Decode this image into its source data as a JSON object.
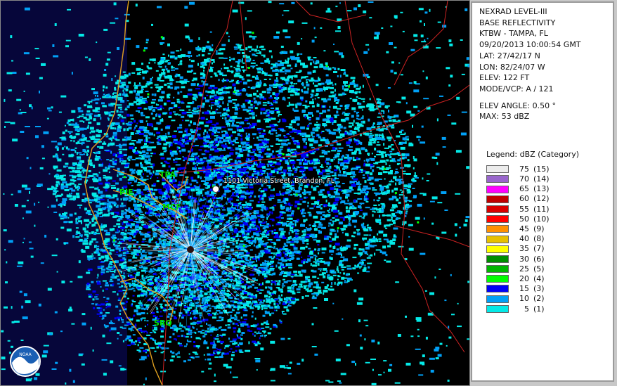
{
  "radar_info": {
    "product": "NEXRAD LEVEL-III",
    "type": "BASE REFLECTIVITY",
    "station": "KTBW - TAMPA, FL",
    "datetime": "09/20/2013 10:00:54 GMT",
    "lat": "LAT: 27/42/17 N",
    "lon": "LON: 82/24/07 W",
    "elev": "ELEV: 122 FT",
    "mode": "MODE/VCP: A / 121",
    "elev_angle": "ELEV ANGLE: 0.50 °",
    "max": "MAX: 53 dBZ"
  },
  "legend": {
    "title": "Legend: dBZ (Category)",
    "items": [
      {
        "dbz": "75",
        "cat": "(15)",
        "color": "#ececec"
      },
      {
        "dbz": "70",
        "cat": "(14)",
        "color": "#9966cc"
      },
      {
        "dbz": "65",
        "cat": "(13)",
        "color": "#ff00ff"
      },
      {
        "dbz": "60",
        "cat": "(12)",
        "color": "#c00000"
      },
      {
        "dbz": "55",
        "cat": "(11)",
        "color": "#d80000"
      },
      {
        "dbz": "50",
        "cat": "(10)",
        "color": "#ff0000"
      },
      {
        "dbz": "45",
        "cat": "(9)",
        "color": "#ff9000"
      },
      {
        "dbz": "40",
        "cat": "(8)",
        "color": "#e7c000"
      },
      {
        "dbz": "35",
        "cat": "(7)",
        "color": "#ffff00"
      },
      {
        "dbz": "30",
        "cat": "(6)",
        "color": "#008e00"
      },
      {
        "dbz": "25",
        "cat": "(5)",
        "color": "#01b501"
      },
      {
        "dbz": "20",
        "cat": "(4)",
        "color": "#02fd02"
      },
      {
        "dbz": "15",
        "cat": "(3)",
        "color": "#0000f6"
      },
      {
        "dbz": "10",
        "cat": "(2)",
        "color": "#01a0f6"
      },
      {
        "dbz": "5",
        "cat": "(1)",
        "color": "#04e9e7"
      }
    ]
  },
  "map": {
    "location_label": "1101 Victoria Street, Brandon, FL",
    "sites": [
      "TPA",
      "PIE",
      "MCF",
      "SRQ"
    ],
    "logo_text": "NOAA",
    "colors": {
      "background": "#000000",
      "roads": "#cc2222",
      "coast": "#e0a020",
      "site_label": "#00e000",
      "echo_5": "#04e9e7",
      "echo_10": "#01a0f6",
      "echo_15": "#0000f6",
      "echo_20": "#02fd02"
    }
  }
}
